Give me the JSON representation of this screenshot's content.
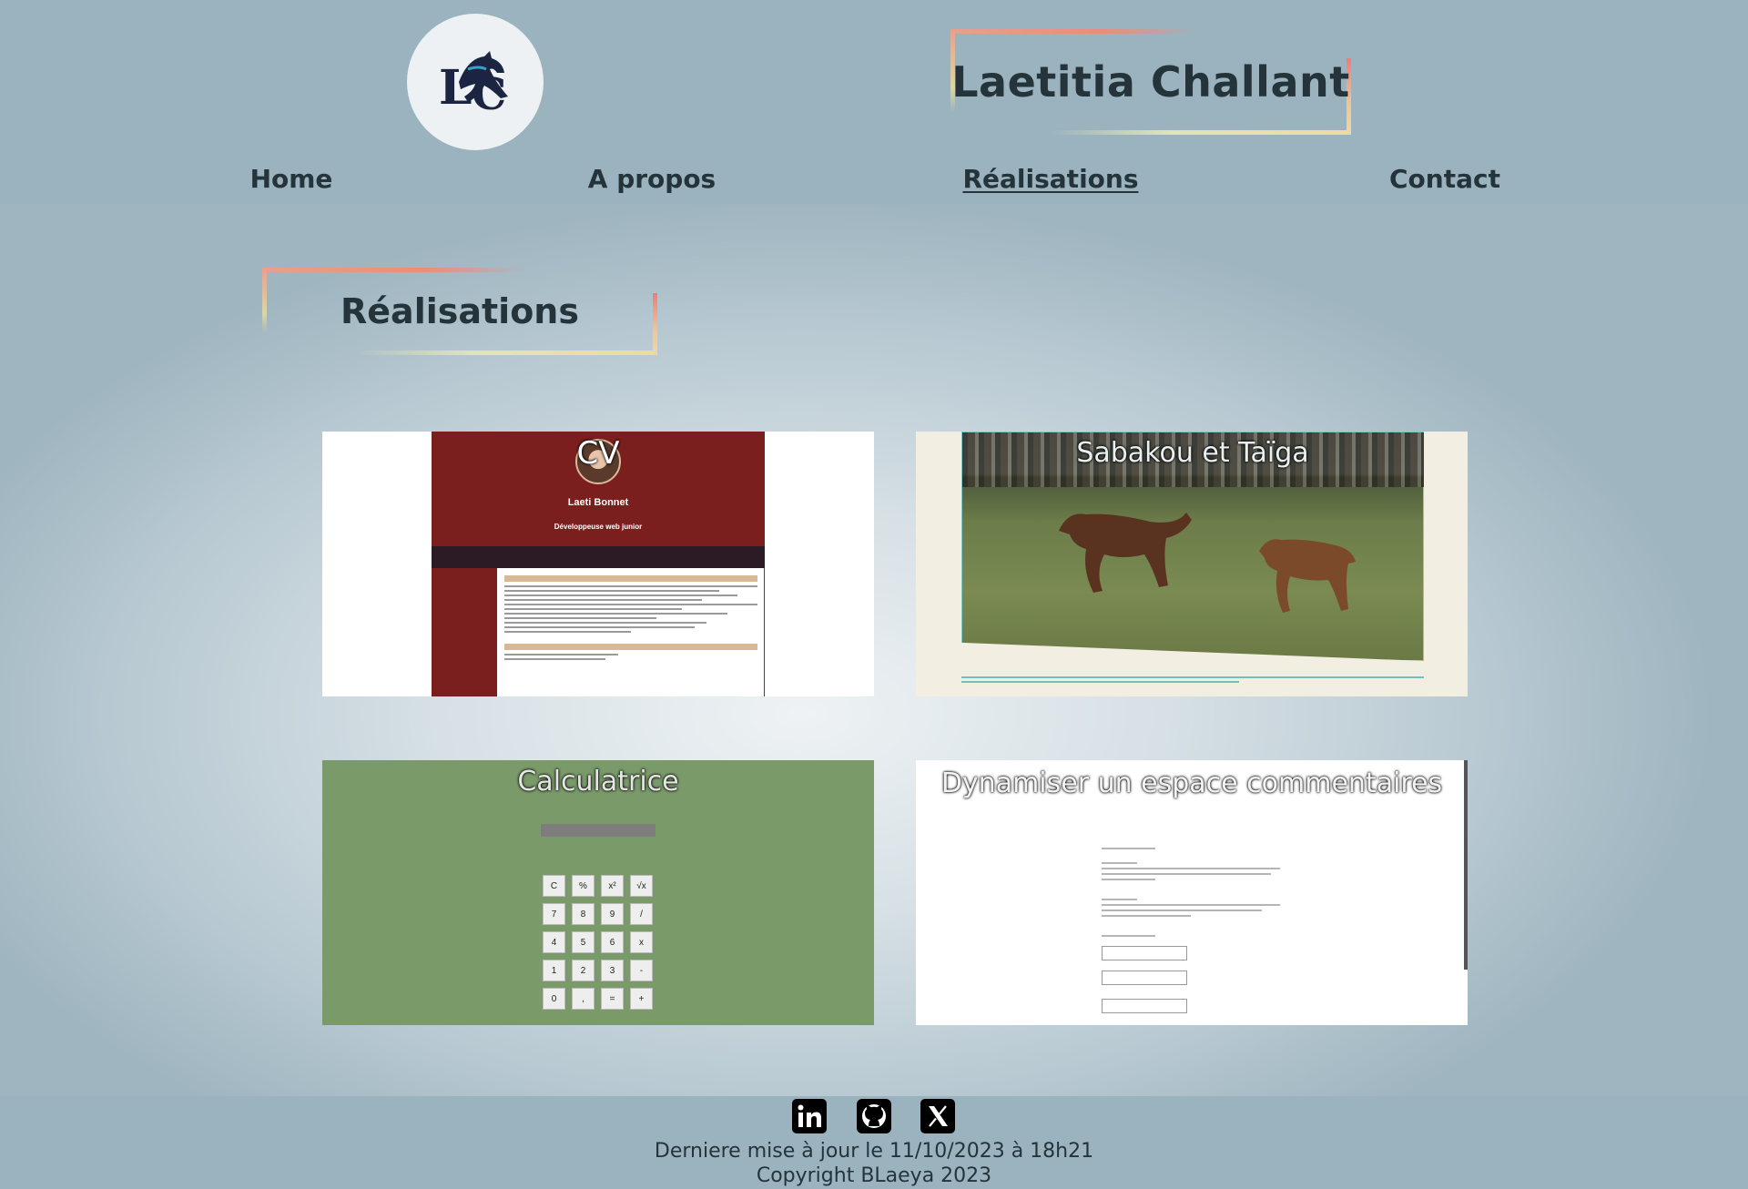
{
  "header": {
    "brand_name": "Laetitia Challant"
  },
  "nav": {
    "items": [
      {
        "label": "Home"
      },
      {
        "label": "A propos"
      },
      {
        "label": "Réalisations"
      },
      {
        "label": "Contact"
      }
    ],
    "active": "Réalisations"
  },
  "main": {
    "section_title": "Réalisations",
    "projects": [
      {
        "title": "CV",
        "name": "Laeti Bonnet",
        "role": "Développeuse web junior"
      },
      {
        "title": "Sabakou et Taïga"
      },
      {
        "title": "Calculatrice",
        "keys": [
          "C",
          "%",
          "x²",
          "√x",
          "7",
          "8",
          "9",
          "/",
          "4",
          "5",
          "6",
          "x",
          "1",
          "2",
          "3",
          "-",
          "0",
          ",",
          "=",
          "+"
        ]
      },
      {
        "title": "Dynamiser un espace commentaires"
      }
    ]
  },
  "footer": {
    "social": [
      "linkedin-icon",
      "github-icon",
      "x-icon"
    ],
    "last_update": "Derniere mise à jour le 11/10/2023 à 18h21",
    "copyright": "Copyright BLaeya 2023"
  },
  "colors": {
    "header_bg": "#9ab3bf",
    "text": "#24343a",
    "cv_red": "#7b1e1e",
    "calc_green": "#7a9a6a"
  }
}
